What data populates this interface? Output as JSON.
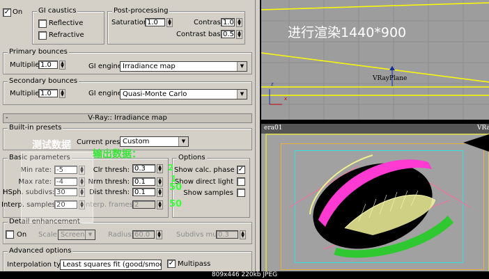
{
  "gi": {
    "on_label": "On",
    "on_checked": true,
    "caustics": {
      "title": "GI caustics",
      "reflective": "Reflective",
      "refractive": "Refractive"
    },
    "post": {
      "title": "Post-processing",
      "saturation_label": "Saturation:",
      "saturation": "1.0",
      "contrast_label": "Contrast:",
      "contrast": "1.0",
      "contrast_base_label": "Contrast base:",
      "contrast_base": "0.5"
    }
  },
  "primary": {
    "title": "Primary bounces",
    "multiplier_label": "Multiplier:",
    "multiplier": "1.0",
    "engine_label": "GI engine:",
    "engine": "Irradiance map"
  },
  "secondary": {
    "title": "Secondary bounces",
    "multiplier_label": "Multiplier:",
    "multiplier": "1.0",
    "engine_label": "GI engine:",
    "engine": "Quasi-Monte Carlo"
  },
  "rollout": {
    "minus": "-",
    "title": "V-Ray:: Irradiance map"
  },
  "presets": {
    "title": "Built-in presets",
    "current_label": "Current preset:",
    "current": "Custom"
  },
  "basic": {
    "title": "Basic parameters",
    "min_rate_label": "Min rate:",
    "min_rate": "-5",
    "max_rate_label": "Max rate:",
    "max_rate": "-4",
    "hsph_label": "HSph. subdivs:",
    "hsph": "30",
    "interp_label": "Interp. samples:",
    "interp": "20",
    "clr_label": "Clr thresh:",
    "clr": "0.3",
    "nrm_label": "Nrm thresh:",
    "nrm": "0.1",
    "dist_label": "Dist thresh:",
    "dist": "0.1",
    "frames_label": "Interp. frames:",
    "frames": "2"
  },
  "options": {
    "title": "Options",
    "show_calc": "Show calc. phase",
    "show_direct": "Show direct light",
    "show_samples": "Show samples"
  },
  "detail": {
    "title": "Detail enhancement",
    "on_label": "On",
    "scale_label": "Scale:",
    "scale": "Screen",
    "radius_label": "Radius:",
    "radius": "60.0",
    "subdivs_label": "Subdivs mult.",
    "subdivs": "0.3"
  },
  "advanced": {
    "title": "Advanced options",
    "interp_type_label": "Interpolation type:",
    "interp_type": "Least squares fit (good/smooth",
    "multipass": "Multipass"
  },
  "annotations": {
    "test_data": "测试数据",
    "output_data": "输出数据：",
    "v1": "2",
    "v2": "1",
    "v3": "50",
    "v4": "50",
    "render": "进行渲染1440*900"
  },
  "viewport": {
    "vray_plane": "VRayPlane",
    "camera": "era01",
    "vray_cut": "VRa"
  },
  "caption": "809x446  220kb  JPEG"
}
